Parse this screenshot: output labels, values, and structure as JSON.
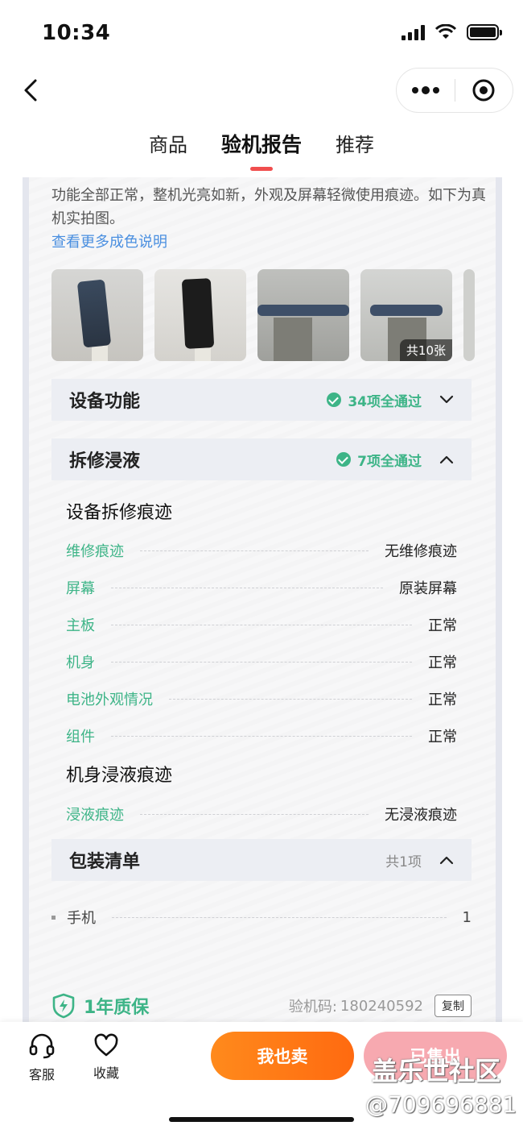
{
  "status": {
    "time": "10:34"
  },
  "tabs": [
    "商品",
    "验机报告",
    "推荐"
  ],
  "report": {
    "description": "功能全部正常，整机光亮如新，外观及屏幕轻微使用痕迹。如下为真机实拍图。",
    "more_link": "查看更多成色说明",
    "photo_count": "共10张",
    "device_function": {
      "title": "设备功能",
      "pass": "34项全通过"
    },
    "repair": {
      "title": "拆修浸液",
      "pass": "7项全通过",
      "group1_title": "设备拆修痕迹",
      "group1": [
        {
          "k": "维修痕迹",
          "v": "无维修痕迹"
        },
        {
          "k": "屏幕",
          "v": "原装屏幕"
        },
        {
          "k": "主板",
          "v": "正常"
        },
        {
          "k": "机身",
          "v": "正常"
        },
        {
          "k": "电池外观情况",
          "v": "正常"
        },
        {
          "k": "组件",
          "v": "正常"
        }
      ],
      "group2_title": "机身浸液痕迹",
      "group2": [
        {
          "k": "浸液痕迹",
          "v": "无浸液痕迹"
        }
      ]
    },
    "package": {
      "title": "包装清单",
      "count": "共1项",
      "items": [
        {
          "k": "手机",
          "v": "1"
        }
      ]
    },
    "warranty": {
      "title": "1年质保",
      "code_label": "验机码:",
      "code": "180240592",
      "copy": "复制"
    }
  },
  "bottom": {
    "service": "客服",
    "favorite": "收藏",
    "sell": "我也卖",
    "sold": "已售出"
  },
  "watermark": {
    "line1": "盖乐世社区",
    "line2": "@709696881"
  },
  "colors": {
    "accent_green": "#3db487",
    "accent_orange": "#ff7a18",
    "tab_underline": "#f04e4e",
    "link": "#4a8fe0"
  }
}
